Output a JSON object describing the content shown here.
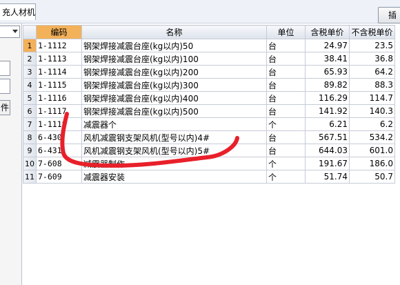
{
  "tab_label": "充人材机",
  "top_button_label": "插",
  "left_panel": {
    "button_label": "件"
  },
  "table": {
    "headers": [
      "",
      "编码",
      "名称",
      "单位",
      "含税单价",
      "不含税单价"
    ],
    "rows": [
      [
        "1",
        "1-1112",
        "钢架焊接减震台座(kg以内)50",
        "台",
        "24.97",
        "23.5"
      ],
      [
        "2",
        "1-1113",
        "钢架焊接减震台座(kg以内)100",
        "台",
        "38.41",
        "36.8"
      ],
      [
        "3",
        "1-1114",
        "钢架焊接减震台座(kg以内)200",
        "台",
        "65.93",
        "64.2"
      ],
      [
        "4",
        "1-1115",
        "钢架焊接减震台座(kg以内)300",
        "台",
        "89.82",
        "88.3"
      ],
      [
        "5",
        "1-1116",
        "钢架焊接减震台座(kg以内)400",
        "台",
        "116.29",
        "114.7"
      ],
      [
        "6",
        "1-1117",
        "钢架焊接减震台座(kg以内)500",
        "台",
        "141.92",
        "140.3"
      ],
      [
        "7",
        "1-1118",
        "减震器个",
        "个",
        "6.21",
        "6.2"
      ],
      [
        "8",
        "6-430",
        "风机减震钢支架风机(型号以内)4#",
        "台",
        "567.51",
        "534.2"
      ],
      [
        "9",
        "6-431",
        "风机减震钢支架风机(型号以内)5#",
        "台",
        "644.03",
        "601.0"
      ],
      [
        "10",
        "7-608",
        "减震器制作",
        "个",
        "191.67",
        "186.0"
      ],
      [
        "11",
        "7-609",
        "减震器安装",
        "个",
        "51.74",
        "50.7"
      ]
    ]
  },
  "colors": {
    "header_highlight": "#f3b15a",
    "annotation_stroke": "#e8202a"
  }
}
